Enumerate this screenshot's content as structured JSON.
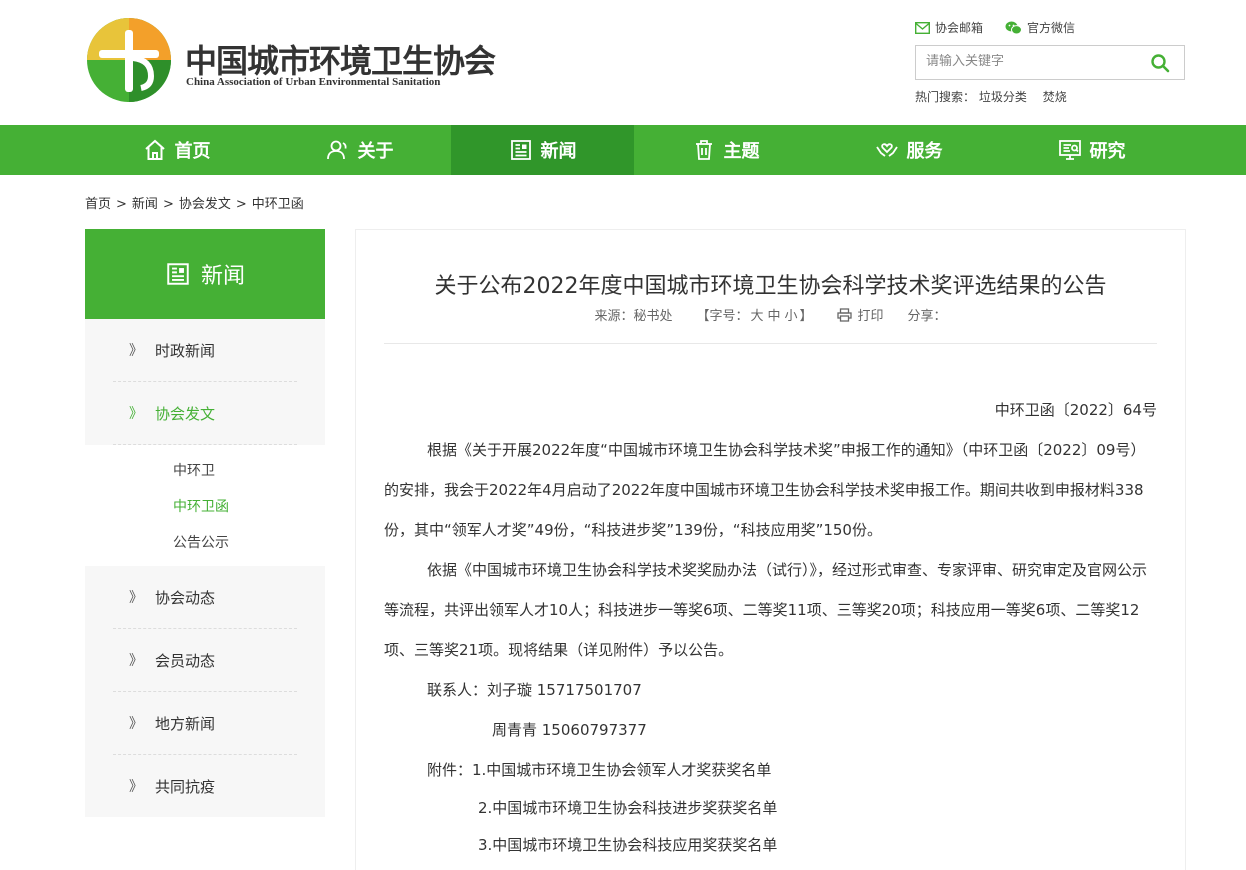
{
  "brand": {
    "name_cn": "中国城市环境卫生协会",
    "name_en": "China Association of Urban Environmental Sanitation",
    "colors": {
      "green": "#45b035",
      "dark_green": "#30962a",
      "orange": "#f3a02a"
    }
  },
  "top_links": {
    "email": "协会邮箱",
    "wechat": "官方微信"
  },
  "search": {
    "placeholder": "请输入关键字",
    "hot_label": "热门搜索：",
    "hot": [
      "垃圾分类",
      "焚烧"
    ]
  },
  "nav": {
    "home": "首页",
    "about": "关于",
    "news": "新闻",
    "topic": "主题",
    "service": "服务",
    "research": "研究",
    "active": "新闻"
  },
  "breadcrumb": [
    "首页",
    "新闻",
    "协会发文",
    "中环卫函"
  ],
  "sidebar": {
    "title": "新闻",
    "items": [
      {
        "label": "时政新闻"
      },
      {
        "label": "协会发文"
      },
      {
        "label": "协会动态"
      },
      {
        "label": "会员动态"
      },
      {
        "label": "地方新闻"
      },
      {
        "label": "共同抗疫"
      }
    ],
    "sub": [
      "中环卫",
      "中环卫函",
      "公告公示"
    ],
    "arrow": "》"
  },
  "article": {
    "title": "关于公布2022年度中国城市环境卫生协会科学技术奖评选结果的公告",
    "source": "来源：秘书处",
    "font_label": "【字号：",
    "font_sizes": [
      "大",
      "中",
      "小"
    ],
    "font_close": "】",
    "print": "打印",
    "share": "分享：",
    "doc_number": "中环卫函〔2022〕64号",
    "para1": "根据《关于开展2022年度“中国城市环境卫生协会科学技术奖”申报工作的通知》（中环卫函〔2022〕09号）的安排，我会于2022年4月启动了2022年度中国城市环境卫生协会科学技术奖申报工作。期间共收到申报材料338份，其中“领军人才奖”49份，“科技进步奖”139份，“科技应用奖”150份。",
    "para2": "依据《中国城市环境卫生协会科学技术奖奖励办法（试行）》，经过形式审查、专家评审、研究审定及官网公示等流程，共评出领军人才10人；科技进步一等奖6项、二等奖11项、三等奖20项；科技应用一等奖6项、二等奖12项、三等奖21项。现将结果（详见附件）予以公告。",
    "contact1": "联系人：刘子璇  15717501707",
    "contact2": "周青青  15060797377",
    "attach1": "附件：1.中国城市环境卫生协会领军人才奖获奖名单",
    "attach2": "2.中国城市环境卫生协会科技进步奖获奖名单",
    "attach3": "3.中国城市环境卫生协会科技应用奖获奖名单"
  }
}
